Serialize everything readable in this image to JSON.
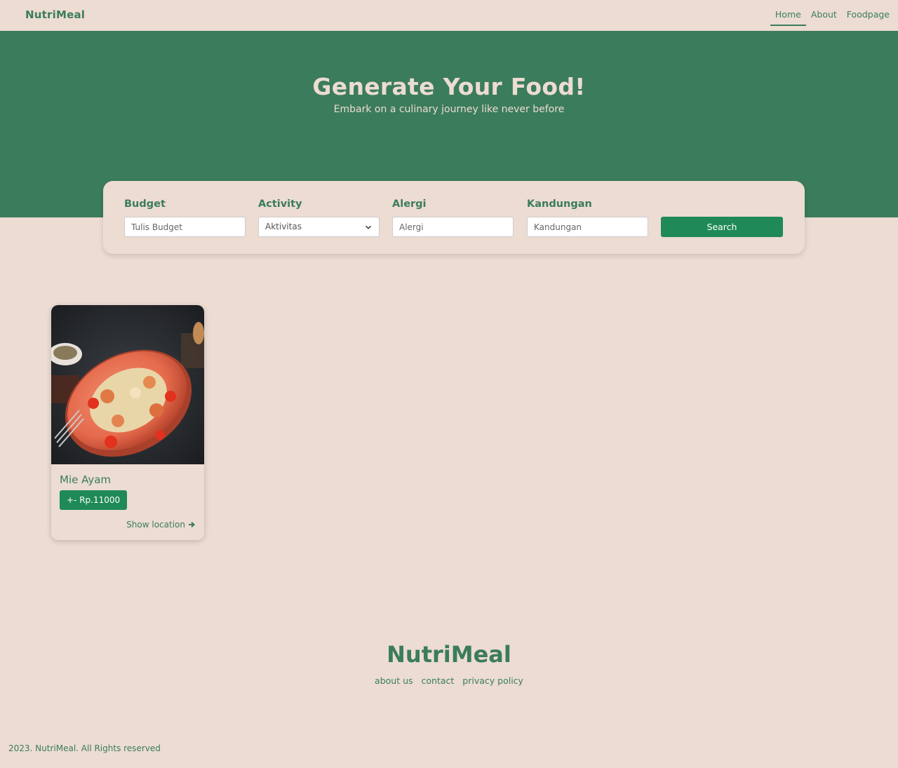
{
  "navbar": {
    "brand": "NutriMeal",
    "links": [
      "Home",
      "About",
      "Foodpage"
    ],
    "active": "Home"
  },
  "hero": {
    "title": "Generate Your Food!",
    "subtitle": "Embark on a culinary journey like never before"
  },
  "search": {
    "budget": {
      "label": "Budget",
      "placeholder": "Tulis Budget"
    },
    "activity": {
      "label": "Activity",
      "selected": "Aktivitas"
    },
    "alergi": {
      "label": "Alergi",
      "placeholder": "Alergi"
    },
    "kandungan": {
      "label": "Kandungan",
      "placeholder": "Kandungan"
    },
    "button": "Search"
  },
  "results": [
    {
      "name": "Mie Ayam",
      "price": "+- Rp.11000",
      "location_link": "Show location"
    }
  ],
  "footer": {
    "brand": "NutriMeal",
    "links": [
      "about us",
      "contact",
      "privacy policy"
    ],
    "copyright": "2023. NutriMeal. All Rights reserved"
  },
  "colors": {
    "background": "#ecdcd2",
    "primary": "#3b7c5c",
    "button": "#1f8a56"
  }
}
